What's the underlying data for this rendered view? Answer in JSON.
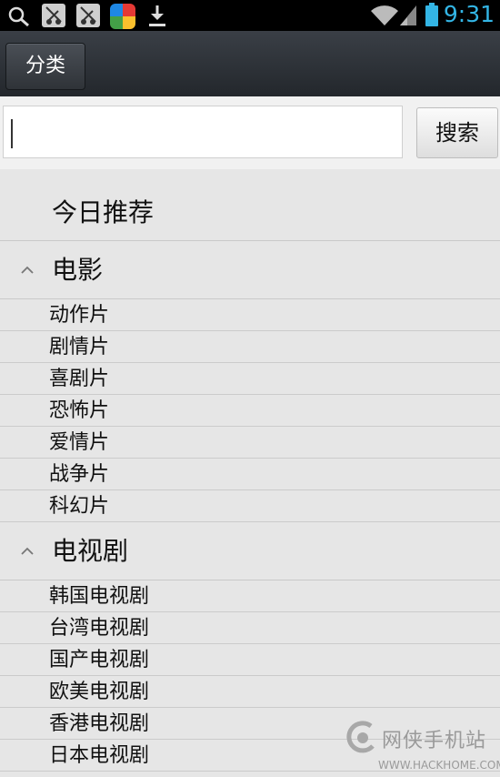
{
  "status_bar": {
    "time": "9:31",
    "icons": [
      "search-icon",
      "app-icon",
      "app-icon",
      "colorful-app-icon",
      "download-icon",
      "wifi-icon",
      "signal-icon",
      "battery-icon"
    ],
    "time_color": "#33b5e5"
  },
  "action_bar": {
    "classify_label": "分类"
  },
  "search": {
    "value": "",
    "button_label": "搜索"
  },
  "recommend": {
    "label": "今日推荐"
  },
  "groups": [
    {
      "title": "电影",
      "items": [
        "动作片",
        "剧情片",
        "喜剧片",
        "恐怖片",
        "爱情片",
        "战争片",
        "科幻片"
      ]
    },
    {
      "title": "电视剧",
      "items": [
        "韩国电视剧",
        "台湾电视剧",
        "国产电视剧",
        "欧美电视剧",
        "香港电视剧",
        "日本电视剧"
      ]
    }
  ],
  "watermark": {
    "cn": "网侠手机站",
    "en": "WWW.HACKHOME.COM"
  }
}
